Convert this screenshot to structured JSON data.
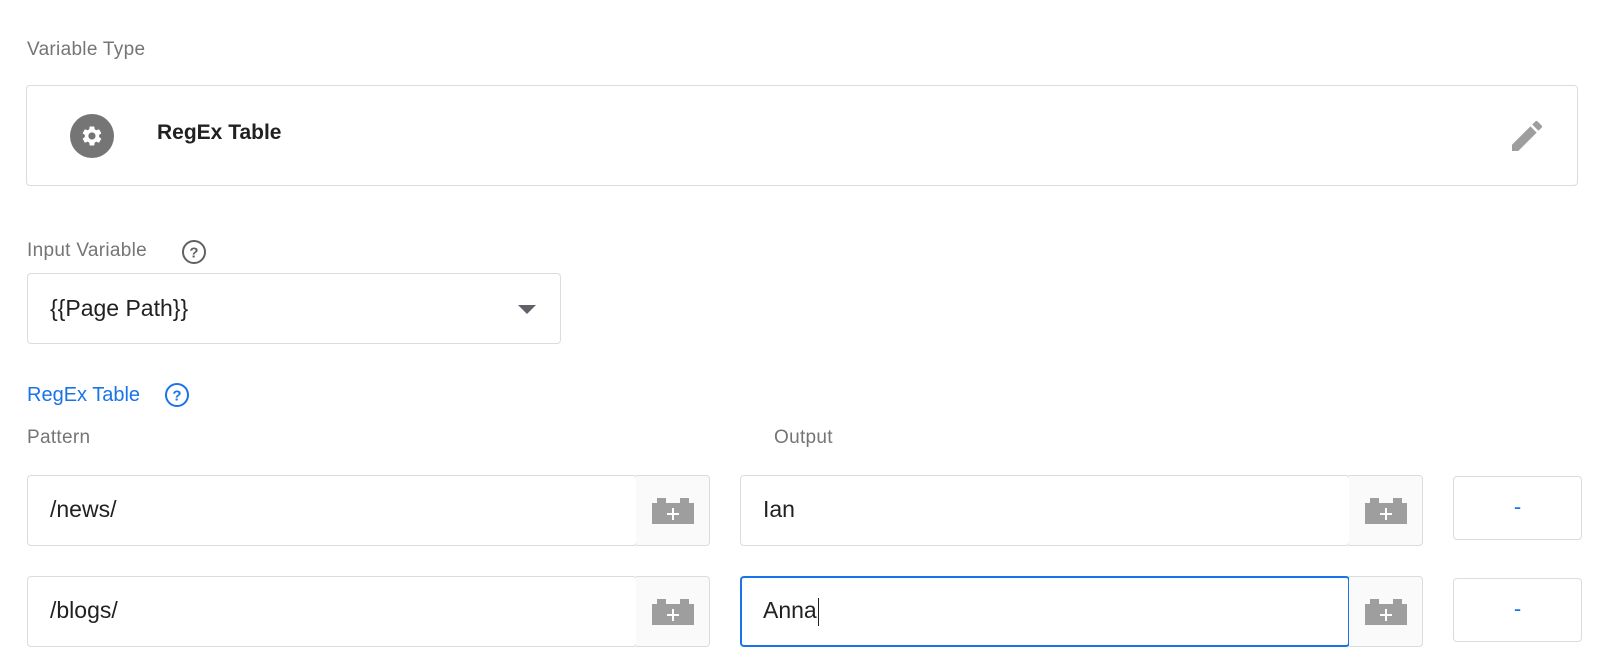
{
  "variable_type": {
    "section_label": "Variable Type",
    "name": "RegEx Table",
    "icon": "gear-icon",
    "edit_icon": "pencil-icon"
  },
  "input_variable": {
    "label": "Input Variable",
    "help_icon": "help-circle-icon",
    "selected": "{{Page Path}}"
  },
  "regex_table": {
    "title": "RegEx Table",
    "help_icon": "help-circle-icon",
    "columns": {
      "pattern": "Pattern",
      "output": "Output"
    },
    "rows": [
      {
        "pattern": "/news/",
        "output": "Ian",
        "remove_label": "-"
      },
      {
        "pattern": "/blogs/",
        "output": "Anna",
        "remove_label": "-"
      }
    ]
  },
  "colors": {
    "accent": "#1a73e8",
    "border": "#dadce0",
    "label": "#757575",
    "icon": "#757575"
  }
}
